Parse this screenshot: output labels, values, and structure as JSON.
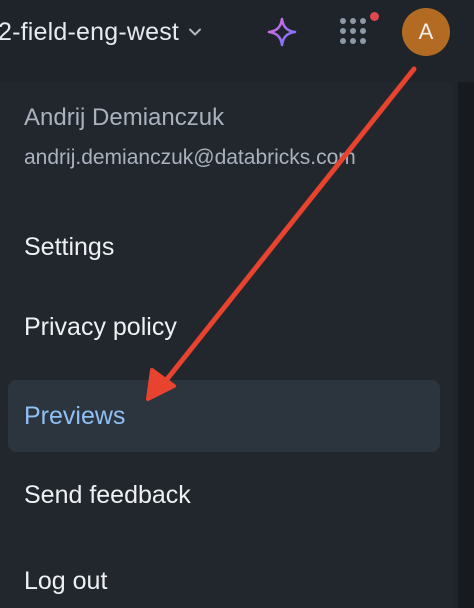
{
  "topbar": {
    "workspace_name": "2-field-eng-west",
    "icons": {
      "workspace_chevron": "chevron-down-icon",
      "assistant": "sparkle-icon",
      "apps": "apps-grid-icon",
      "notification": "notification-dot"
    },
    "avatar_initial": "A"
  },
  "account": {
    "name": "Andrij Demianczuk",
    "email": "andrij.demianczuk@databricks.com"
  },
  "menu": {
    "items": [
      {
        "label": "Settings"
      },
      {
        "label": "Privacy policy"
      },
      {
        "label": "Previews",
        "highlighted": true
      },
      {
        "label": "Send feedback"
      },
      {
        "label": "Log out"
      }
    ]
  },
  "annotation": {
    "arrow_color": "#e7432f"
  },
  "colors": {
    "background": "#1f242b",
    "menu_text": "#eef1f4",
    "muted_text": "#a9b2bd",
    "highlight_bg": "#2c343e",
    "highlight_text": "#8fc0f4",
    "avatar_bg": "#b36b24",
    "notification": "#e0484f"
  }
}
